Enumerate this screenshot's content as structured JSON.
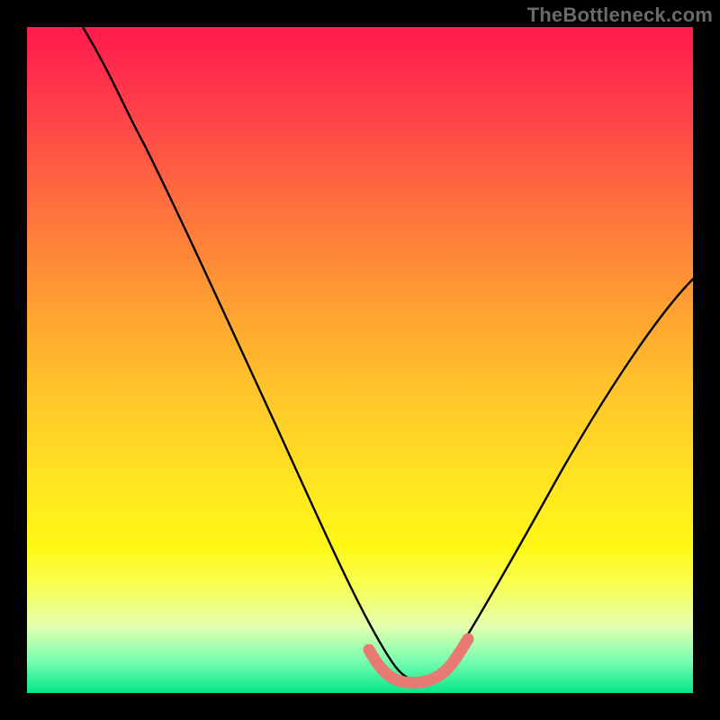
{
  "watermark": "TheBottleneck.com",
  "chart_data": {
    "type": "line",
    "title": "",
    "xlabel": "",
    "ylabel": "",
    "xlim": [
      0,
      100
    ],
    "ylim": [
      0,
      100
    ],
    "grid": false,
    "legend": false,
    "series": [
      {
        "name": "bottleneck-curve",
        "color": "#000000",
        "x": [
          9,
          12,
          16,
          20,
          24,
          28,
          32,
          36,
          40,
          44,
          48,
          51,
          54,
          56,
          58,
          60,
          62,
          65,
          70,
          76,
          82,
          88,
          94,
          100
        ],
        "y": [
          100,
          94,
          87,
          80,
          72,
          64,
          56,
          48,
          40,
          32,
          24,
          16,
          9,
          5,
          3,
          3,
          5,
          9,
          18,
          28,
          38,
          47,
          55,
          62
        ]
      },
      {
        "name": "valley-highlight",
        "color": "#e97a73",
        "x": [
          51,
          53,
          55,
          57,
          59,
          61,
          63,
          65
        ],
        "y": [
          10,
          6,
          4,
          3,
          3,
          4,
          6,
          10
        ]
      }
    ],
    "annotations": []
  }
}
